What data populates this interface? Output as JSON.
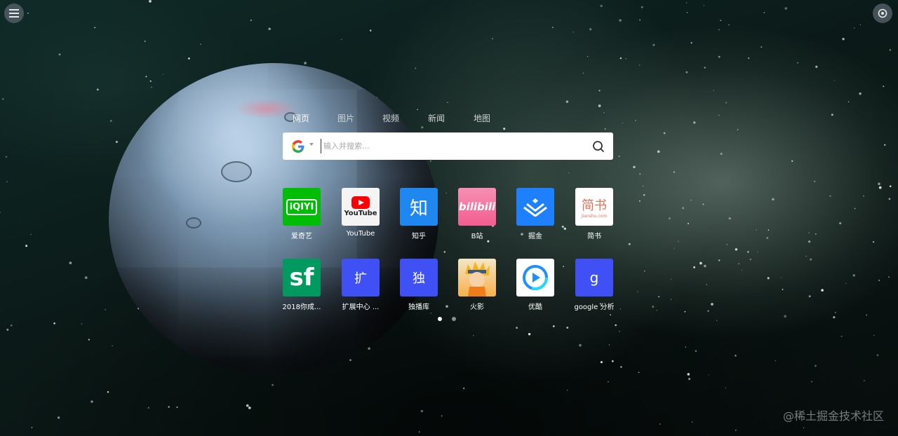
{
  "colors": {
    "tile_blue": "#3f51f5",
    "iqiyi_green": "#00be06",
    "zhihu_blue": "#1f87f0",
    "juejin_blue": "#1e80ff",
    "sf_green": "#009a61",
    "bilibili_pink": "#f25d8e",
    "jianshu_red": "#ea6f5a",
    "youku_blue": "#1f8fff",
    "dot_active": "#ffffff",
    "dot_inactive": "#8a8f8e"
  },
  "search_tabs": [
    {
      "label": "网页",
      "active": true
    },
    {
      "label": "图片",
      "active": false
    },
    {
      "label": "视频",
      "active": false
    },
    {
      "label": "新闻",
      "active": false
    },
    {
      "label": "地图",
      "active": false
    }
  ],
  "search": {
    "engine_icon": "google-g-icon",
    "placeholder": "输入并搜索..."
  },
  "tiles": [
    {
      "label": "爱奇艺",
      "icon": "iqiyi-icon",
      "glyph": "iQIYI"
    },
    {
      "label": "YouTube",
      "icon": "youtube-icon",
      "glyph": "YouTube"
    },
    {
      "label": "知乎",
      "icon": "zhihu-icon",
      "glyph": "知"
    },
    {
      "label": "B站",
      "icon": "bilibili-icon",
      "glyph": "bilibili"
    },
    {
      "label": "掘金",
      "icon": "juejin-icon",
      "glyph": ""
    },
    {
      "label": "简书",
      "icon": "jianshu-icon",
      "glyph": "简书",
      "sub": "Jianshu.com"
    },
    {
      "label": "2018你成...",
      "icon": "segmentfault-icon",
      "glyph": "sf"
    },
    {
      "label": "扩展中心 ...",
      "icon": "extension-center-icon",
      "glyph": "扩"
    },
    {
      "label": "独播库",
      "icon": "dubolu-icon",
      "glyph": "独"
    },
    {
      "label": "火影",
      "icon": "naruto-icon",
      "glyph": ""
    },
    {
      "label": "优酷",
      "icon": "youku-icon",
      "glyph": ""
    },
    {
      "label": "google 分析",
      "icon": "google-analytics-icon",
      "glyph": "g"
    }
  ],
  "pagination": {
    "pages": 2,
    "current": 1
  },
  "watermark": "@稀土掘金技术社区"
}
